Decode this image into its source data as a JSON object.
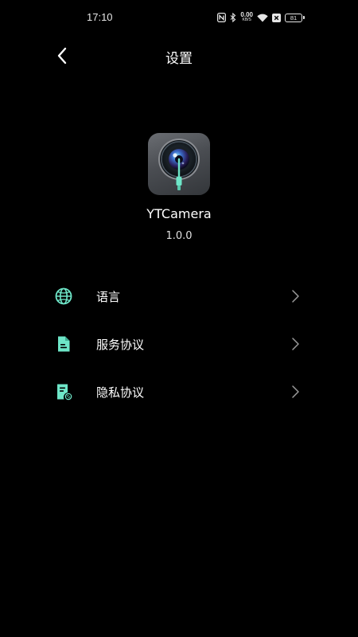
{
  "status_bar": {
    "time": "17:10",
    "net_speed": "0.00",
    "net_speed_unit": "KB/S",
    "battery": "81",
    "icons": [
      "nfc-icon",
      "bluetooth-icon",
      "wifi-icon",
      "sim-off-icon",
      "battery-icon"
    ]
  },
  "header": {
    "title": "设置",
    "back_icon": "chevron-left-icon"
  },
  "app": {
    "name": "YTCamera",
    "version": "1.0.0",
    "icon": "camera-lens-app-icon"
  },
  "menu": {
    "items": [
      {
        "label": "语言",
        "icon": "globe-icon"
      },
      {
        "label": "服务协议",
        "icon": "document-icon"
      },
      {
        "label": "隐私协议",
        "icon": "privacy-document-icon"
      }
    ]
  },
  "colors": {
    "background": "#000000",
    "accent": "#6ee6c8",
    "text": "#ffffff",
    "chevron": "#9a9a9a"
  }
}
